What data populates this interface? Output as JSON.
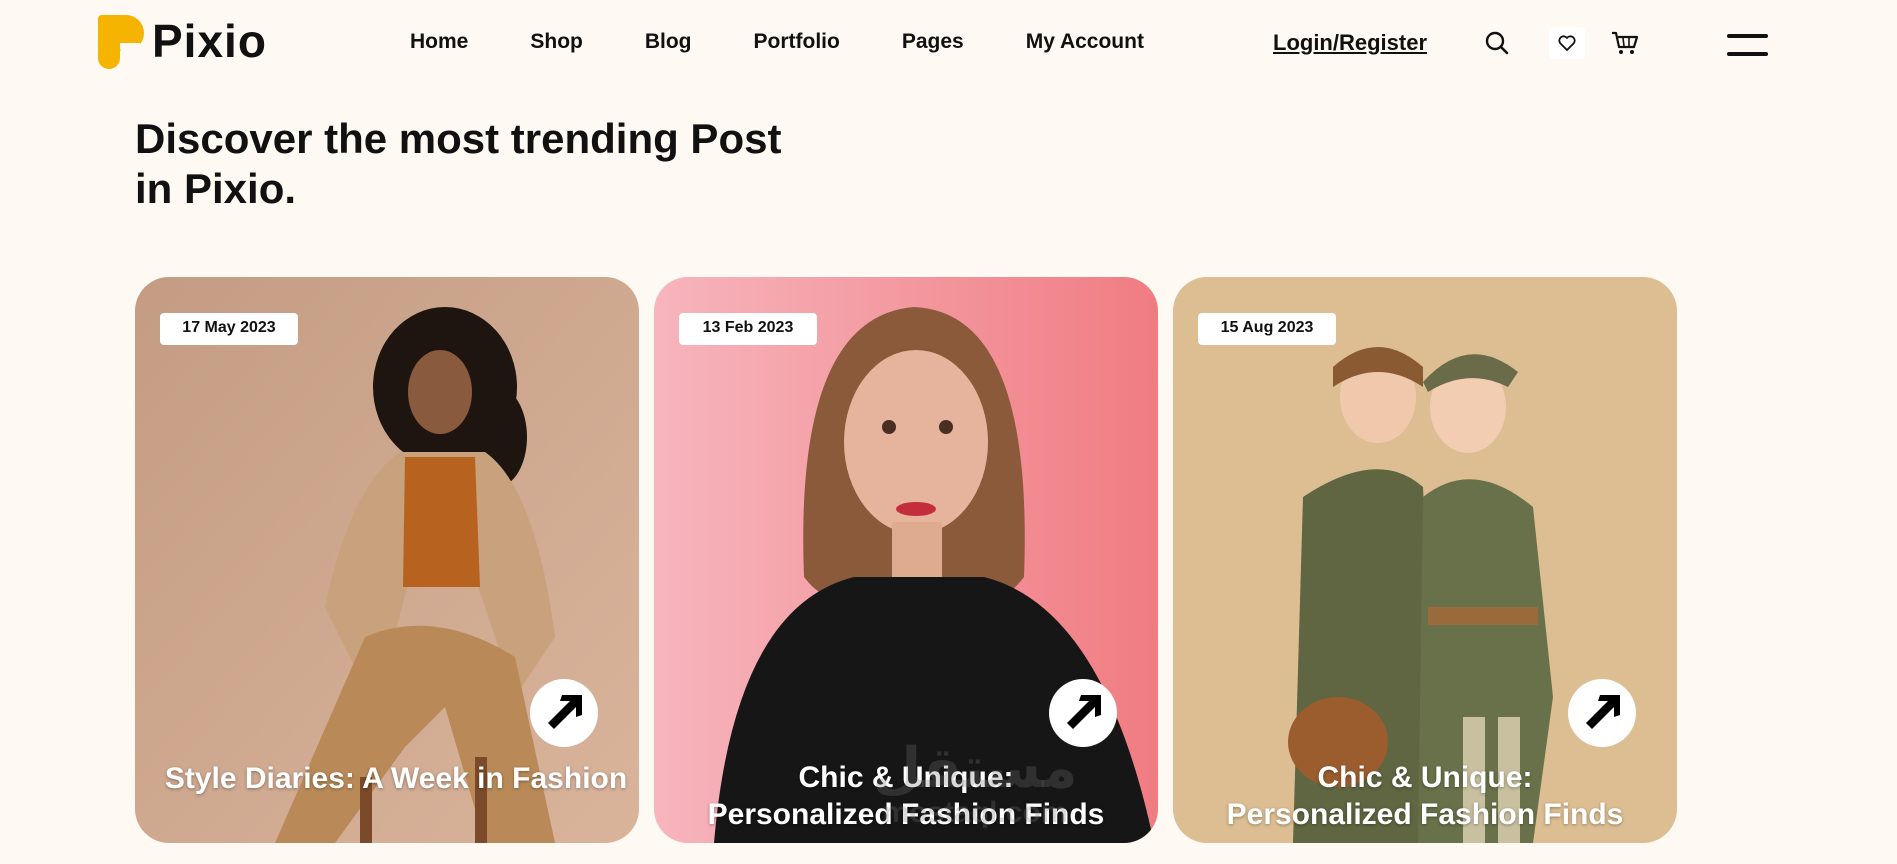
{
  "brand": {
    "name": "Pixio",
    "accent": "#f5b400"
  },
  "nav": {
    "items": [
      {
        "label": "Home"
      },
      {
        "label": "Shop"
      },
      {
        "label": "Blog"
      },
      {
        "label": "Portfolio"
      },
      {
        "label": "Pages"
      },
      {
        "label": "My Account"
      }
    ],
    "login_label": "Login/Register",
    "icons": [
      "search-icon",
      "heart-icon",
      "cart-icon",
      "hamburger-menu-icon"
    ]
  },
  "hero": {
    "title_line1": "Discover the most trending Post",
    "title_line2": "in Pixio."
  },
  "posts": [
    {
      "date": "17 May 2023",
      "title": "Style Diaries: A Week in Fashion",
      "image": "woman in tan satin suit on chair",
      "bg": "#c59a7c"
    },
    {
      "date": "13 Feb 2023",
      "title_line1": "Chic & Unique:",
      "title_line2": "Personalized Fashion Finds",
      "image": "woman with wavy hair on pink background",
      "bg": "#f2a2ac"
    },
    {
      "date": "15 Aug 2023",
      "title_line1": "Chic & Unique:",
      "title_line2": "Personalized Fashion Finds",
      "image": "two girls in olive safari outfits",
      "bg": "#d6b689"
    }
  ],
  "watermark": {
    "arabic": "مستقل",
    "latin": "mostaql.com"
  }
}
